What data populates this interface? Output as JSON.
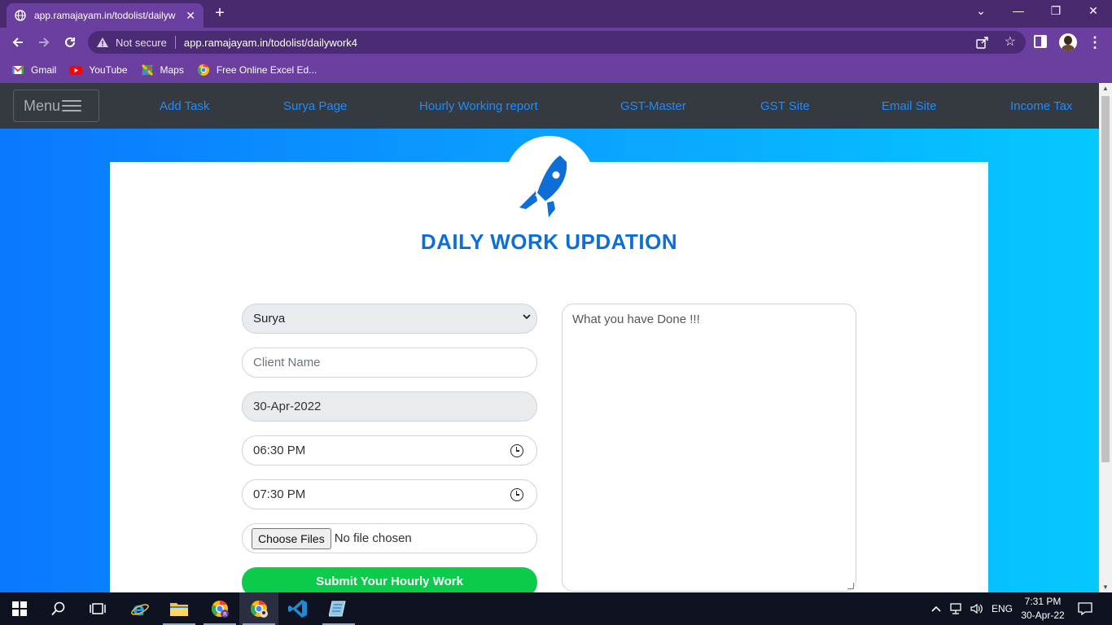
{
  "browser": {
    "tab_title": "app.ramajayam.in/todolist/daily​w",
    "new_tab": "+",
    "security_label": "Not secure",
    "url": "app.ramajayam.in/todolist/dailywork4",
    "bookmarks": [
      {
        "label": "Gmail",
        "icon": "gmail-icon"
      },
      {
        "label": "YouTube",
        "icon": "youtube-icon"
      },
      {
        "label": "Maps",
        "icon": "maps-icon"
      },
      {
        "label": "Free Online Excel Ed...",
        "icon": "chrome-icon"
      }
    ]
  },
  "navbar": {
    "menu_label": "Menu",
    "links": [
      "Add Task",
      "Surya Page",
      "Hourly Working report",
      "GST-Master",
      "GST Site",
      "Email Site",
      "Income Tax"
    ]
  },
  "form": {
    "title": "DAILY WORK UPDATION",
    "name_select": "Surya",
    "client_placeholder": "Client Name",
    "date_value": "30-Apr-2022",
    "start_time": "06:30 PM",
    "end_time": "07:30 PM",
    "file_button": "Choose Files",
    "file_status": "No file chosen",
    "submit_label": "Submit Your Hourly Work",
    "work_placeholder": "What you have Done !!!"
  },
  "taskbar": {
    "language": "ENG",
    "time": "7:31 PM",
    "date": "30-Apr-22"
  },
  "colors": {
    "browser_frame": "#6a3fa0",
    "navbar": "#343a40",
    "nav_link": "#1e8cff",
    "title": "#0d6fd6",
    "submit": "#0bcc4a"
  }
}
